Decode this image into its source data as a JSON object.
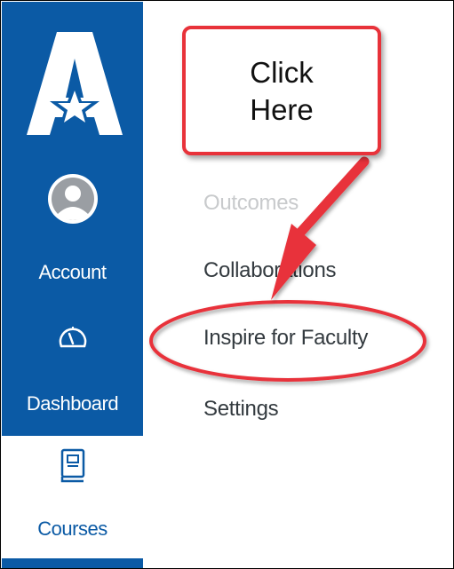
{
  "global_nav": {
    "account_label": "Account",
    "dashboard_label": "Dashboard",
    "courses_label": "Courses",
    "colors": {
      "sidebar_bg": "#0b5aa5",
      "active_bg": "#ffffff",
      "active_text": "#0b5aa5"
    }
  },
  "course_nav": {
    "items": [
      {
        "label": "Outcomes",
        "state": "disabled"
      },
      {
        "label": "Collaborations",
        "state": "normal"
      },
      {
        "label": "Inspire for Faculty",
        "state": "highlighted"
      },
      {
        "label": "Settings",
        "state": "normal"
      }
    ]
  },
  "annotation": {
    "callout_line1": "Click",
    "callout_line2": "Here",
    "color": "#e8323a"
  }
}
